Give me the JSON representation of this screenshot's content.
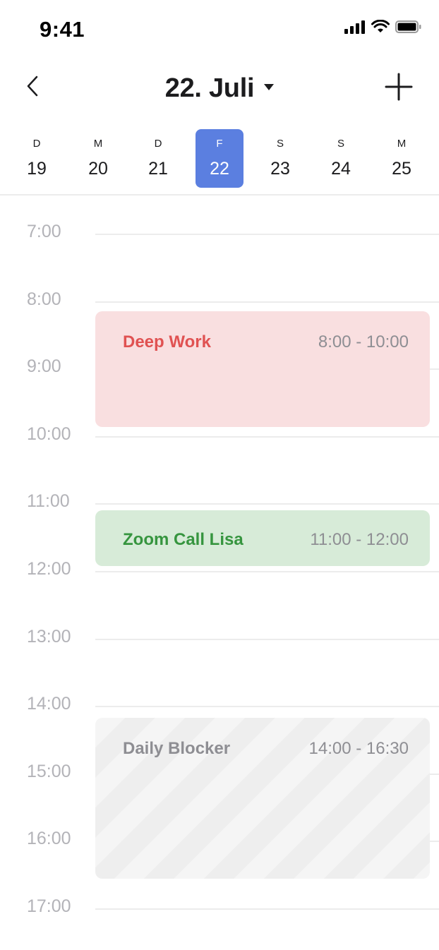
{
  "status_bar": {
    "time": "9:41",
    "icons": [
      "cellular-signal-icon",
      "wifi-icon",
      "battery-icon"
    ]
  },
  "header": {
    "title": "22. Juli",
    "back_icon": "chevron-left-icon",
    "dropdown_icon": "caret-down-icon",
    "add_icon": "plus-icon"
  },
  "week": {
    "days": [
      {
        "letter": "D",
        "number": "19"
      },
      {
        "letter": "M",
        "number": "20"
      },
      {
        "letter": "D",
        "number": "21"
      },
      {
        "letter": "F",
        "number": "22",
        "selected": true
      },
      {
        "letter": "S",
        "number": "23"
      },
      {
        "letter": "S",
        "number": "24"
      },
      {
        "letter": "M",
        "number": "25"
      }
    ],
    "selected_color": "#5b7fe0"
  },
  "timeline": {
    "hours": [
      "7:00",
      "8:00",
      "9:00",
      "10:00",
      "11:00",
      "12:00",
      "13:00",
      "14:00",
      "15:00",
      "16:00",
      "17:00"
    ],
    "events": [
      {
        "title": "Deep Work",
        "time": "8:00 - 10:00",
        "color": "#e05252",
        "background": "#f9dfe0"
      },
      {
        "title": "Zoom Call Lisa",
        "time": "11:00 - 12:00",
        "color": "#36953f",
        "background": "#d7ebd8"
      },
      {
        "title": "Daily Blocker",
        "time": "14:00 - 16:30",
        "color": "#8e8e93",
        "background": "striped-gray"
      }
    ]
  }
}
